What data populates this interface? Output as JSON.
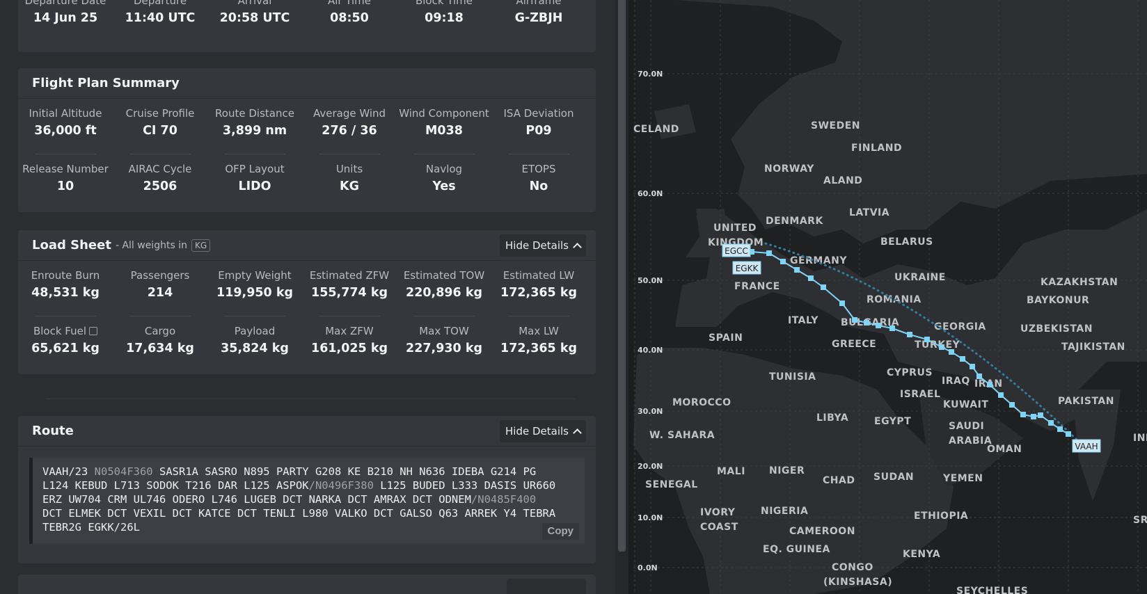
{
  "flight_times": {
    "items": [
      {
        "label": "Departure Date",
        "value": "14 Jun 25"
      },
      {
        "label": "Departure",
        "value": "11:40 UTC"
      },
      {
        "label": "Arrival",
        "value": "20:58 UTC"
      },
      {
        "label": "Air Time",
        "value": "08:50"
      },
      {
        "label": "Block Time",
        "value": "09:18"
      },
      {
        "label": "Airframe",
        "value": "G-ZBJH"
      }
    ]
  },
  "flight_plan_summary": {
    "title": "Flight Plan Summary",
    "items": [
      {
        "label": "Initial Altitude",
        "value": "36,000 ft"
      },
      {
        "label": "Cruise Profile",
        "value": "CI 70"
      },
      {
        "label": "Route Distance",
        "value": "3,899 nm"
      },
      {
        "label": "Average Wind",
        "value": "276 / 36"
      },
      {
        "label": "Wind Component",
        "value": "M038"
      },
      {
        "label": "ISA Deviation",
        "value": "P09"
      },
      {
        "label": "Release Number",
        "value": "10"
      },
      {
        "label": "AIRAC Cycle",
        "value": "2506"
      },
      {
        "label": "OFP Layout",
        "value": "LIDO"
      },
      {
        "label": "Units",
        "value": "KG"
      },
      {
        "label": "Navlog",
        "value": "Yes"
      },
      {
        "label": "ETOPS",
        "value": "No"
      }
    ]
  },
  "load_sheet": {
    "title": "Load Sheet",
    "subtitle": "- All weights in",
    "unit_badge": "KG",
    "hide_label": "Hide Details",
    "items": [
      {
        "label": "Enroute Burn",
        "value": "48,531 kg"
      },
      {
        "label": "Passengers",
        "value": "214"
      },
      {
        "label": "Empty Weight",
        "value": "119,950 kg"
      },
      {
        "label": "Estimated ZFW",
        "value": "155,774 kg"
      },
      {
        "label": "Estimated TOW",
        "value": "220,896 kg"
      },
      {
        "label": "Estimated LW",
        "value": "172,365 kg"
      },
      {
        "label": "Block Fuel",
        "value": "65,621 kg"
      },
      {
        "label": "Cargo",
        "value": "17,634 kg"
      },
      {
        "label": "Payload",
        "value": "35,824 kg"
      },
      {
        "label": "Max ZFW",
        "value": "161,025 kg"
      },
      {
        "label": "Max TOW",
        "value": "227,930 kg"
      },
      {
        "label": "Max LW",
        "value": "172,365 kg"
      }
    ]
  },
  "route": {
    "title": "Route",
    "hide_label": "Hide Details",
    "copy_label": "Copy",
    "lines": [
      [
        {
          "t": "VAAH/23 "
        },
        {
          "t": "N0504F360",
          "m": true
        },
        {
          "t": " SASR1A SASRO N895 PARTY G208 KE B210 NH N636 IDEBA G214 PG"
        }
      ],
      [
        {
          "t": "L124 KEBUD L713 SODOK T216 DAR L125 ASPOK"
        },
        {
          "t": "/N0496F380",
          "m": true
        },
        {
          "t": " L125 BUDED L333 DASIS UR660"
        }
      ],
      [
        {
          "t": "ERZ UW704 CRM UL746 ODERO L746 LUGEB DCT NARKA DCT AMRAX DCT ODNEM"
        },
        {
          "t": "/N0485F400",
          "m": true
        }
      ],
      [
        {
          "t": "DCT ELMEK DCT VEXIL DCT KATCE DCT TENLI L980 VALKO DCT GALSO Q63 ARREK Y4 TEBRA"
        }
      ],
      [
        {
          "t": "TEBR2G EGKK/26L"
        }
      ]
    ]
  },
  "map": {
    "lat_labels": [
      "70.0N",
      "60.0N",
      "50.0N",
      "40.0N",
      "30.0N",
      "20.0N",
      "10.0N",
      "0.0N"
    ],
    "countries": [
      "CELAND",
      "SWEDEN",
      "FINLAND",
      "NORWAY",
      "ALAND",
      "DENMARK",
      "LATVIA",
      "UNITED",
      "KINGDOM",
      "BELARUS",
      "GERMANY",
      "FRANCE",
      "UKRAINE",
      "KAZAKHSTAN",
      "BAYKONUR",
      "ROMANIA",
      "ITALY",
      "BULGARIA",
      "GEORGIA",
      "UZBEKISTAN",
      "SPAIN",
      "GREECE",
      "TURKEY",
      "TAJIKISTAN",
      "TUNISIA",
      "CYPRUS",
      "IRAQ",
      "IRAN",
      "ISRAEL",
      "PAKISTAN",
      "MOROCCO",
      "KUWAIT",
      "LIBYA",
      "EGYPT",
      "SAUDI",
      "ARABIA",
      "W. SAHARA",
      "OMAN",
      "INDIA",
      "MALI",
      "NIGER",
      "CHAD",
      "SUDAN",
      "YEMEN",
      "SENEGAL",
      "IVORY",
      "COAST",
      "NIGERIA",
      "ETHIOPIA",
      "CAMEROON",
      "SRI LANKA",
      "EQ. GUINEA",
      "KENYA",
      "CONGO",
      "(KINSHASA)",
      "SEYCHELLES"
    ],
    "airports": [
      "EGCC",
      "EGKK",
      "VAAH"
    ]
  },
  "colors": {
    "route_line": "#7fd3f5",
    "map_bg": "#1f2022",
    "panel_bg": "#35373c"
  }
}
